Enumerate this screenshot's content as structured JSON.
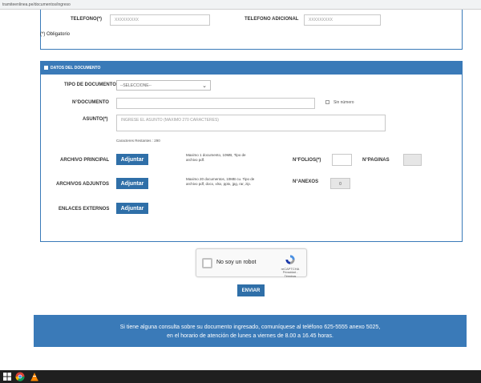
{
  "browser": {
    "url": "tramiteenlinea.pe/documentos/ingreso"
  },
  "top_fields": {
    "telefono_label": "TELEFONO(*)",
    "telefono_placeholder": "XXXXXXXXX",
    "telefono_adicional_label": "TELEFONO ADICIONAL",
    "telefono_adicional_placeholder": "XXXXXXXXX",
    "obligatorio_text": "(*) Obligatorio"
  },
  "documento": {
    "header": "DATOS DEL DOCUMENTO",
    "tipo_label": "TIPO DE DOCUMENTO(*)",
    "tipo_selected": "--SELECCIONE--",
    "numero_label": "N°DOCUMENTO",
    "numero_value": "",
    "sin_numero_label": "Sin número",
    "asunto_label": "ASUNTO(*)",
    "asunto_placeholder": "INGRESE EL ASUNTO (MAXIMO 270 CARACTERES)",
    "caracteres_text": "Caracteres Restantes : 290",
    "archivo_principal_label": "ARCHIVO PRINCIPAL",
    "archivo_principal_note": "Maximo 1 documento, 10MB, Tipo de archivo pdf.",
    "adjuntar_label": "Adjuntar",
    "folios_label": "N°FOLIOS(*)",
    "folios_value": "",
    "paginas_label": "N°PAGINAS",
    "paginas_value": "",
    "archivos_adjuntos_label": "ARCHIVOS ADJUNTOS",
    "archivos_adjuntos_note": "Maximo 20 documentos, 10MB cu. Tipo de archivo pdf, docx, xlsx, pptx, jpg, rar, zip.",
    "anexos_label": "N°ANEXOS",
    "anexos_value": "0",
    "enlaces_label": "ENLACES EXTERNOS"
  },
  "captcha": {
    "text": "No soy un robot",
    "brand": "reCAPTCHA",
    "links": "Privacidad - Términos"
  },
  "enviar_label": "ENVIAR",
  "footer": {
    "line1": "Si tiene alguna consulta sobre su documento ingresado, comuníquese al teléfono 625-5555 anexo 5025,",
    "line2": "en el horario de atención de lunes a viernes de 8.00 a 16.45 horas."
  },
  "taskbar": {
    "icons": [
      "windows-start-icon",
      "file-explorer-icon",
      "chrome-icon",
      "vlc-icon"
    ]
  },
  "colors": {
    "accent": "#3a7ab8",
    "button": "#2f6fa8"
  }
}
